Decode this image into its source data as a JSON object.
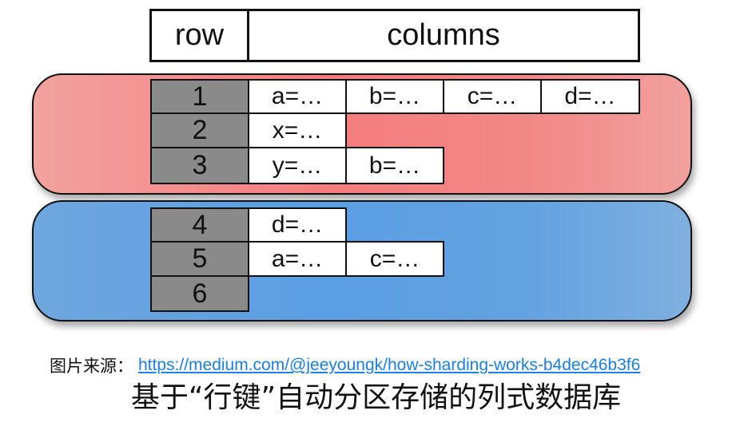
{
  "header": {
    "row_label": "row",
    "columns_label": "columns"
  },
  "shards": [
    {
      "name": "red",
      "color": "#f4807e",
      "rows": [
        {
          "key": "1",
          "cells": [
            "a=…",
            "b=…",
            "c=…",
            "d=…"
          ]
        },
        {
          "key": "2",
          "cells": [
            "x=…"
          ]
        },
        {
          "key": "3",
          "cells": [
            "y=…",
            "b=…"
          ]
        }
      ]
    },
    {
      "name": "blue",
      "color": "#5c9fe2",
      "rows": [
        {
          "key": "4",
          "cells": [
            "d=…"
          ]
        },
        {
          "key": "5",
          "cells": [
            "a=…",
            "c=…"
          ]
        },
        {
          "key": "6",
          "cells": []
        }
      ]
    }
  ],
  "source": {
    "label": "图片来源：",
    "url": "https://medium.com/@jeeyoungk/how-sharding-works-b4dec46b3f6"
  },
  "caption": "基于“行键”自动分区存储的列式数据库"
}
